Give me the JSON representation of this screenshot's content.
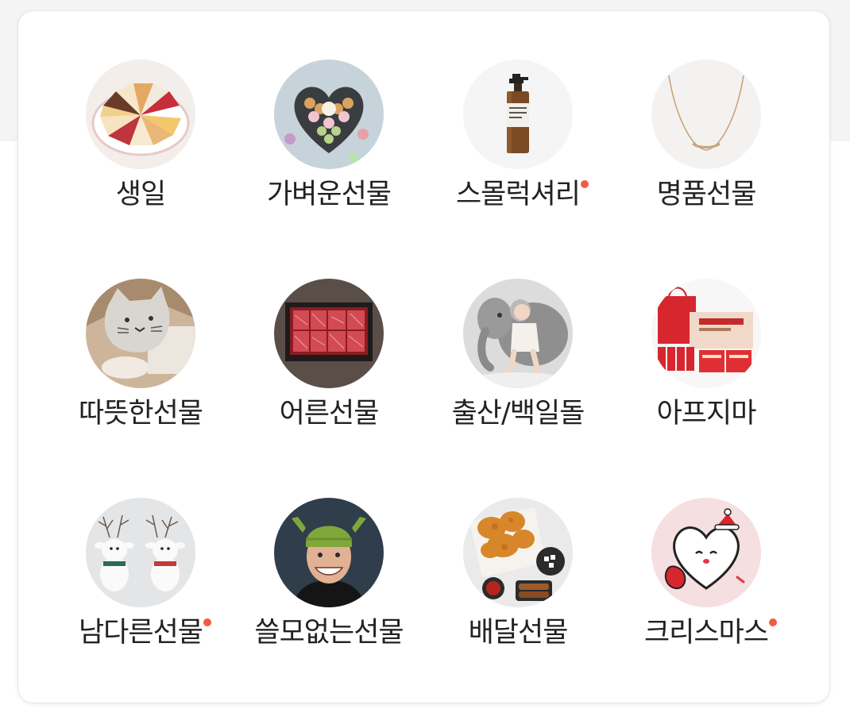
{
  "categories": [
    {
      "label": "생일",
      "icon": "birthday-cake-icon",
      "new": false
    },
    {
      "label": "가벼운선물",
      "icon": "macaron-box-icon",
      "new": false
    },
    {
      "label": "스몰럭셔리",
      "icon": "perfume-bottle-icon",
      "new": true
    },
    {
      "label": "명품선물",
      "icon": "necklace-icon",
      "new": false
    },
    {
      "label": "따뜻한선물",
      "icon": "cat-cushion-icon",
      "new": false
    },
    {
      "label": "어른선물",
      "icon": "beef-box-icon",
      "new": false
    },
    {
      "label": "출산/백일돌",
      "icon": "baby-elephant-icon",
      "new": false
    },
    {
      "label": "아프지마",
      "icon": "red-ginseng-gift-icon",
      "new": false
    },
    {
      "label": "남다른선물",
      "icon": "reindeer-figures-icon",
      "new": true
    },
    {
      "label": "쓸모없는선물",
      "icon": "shrek-hat-man-icon",
      "new": false
    },
    {
      "label": "배달선물",
      "icon": "fried-chicken-icon",
      "new": false
    },
    {
      "label": "크리스마스",
      "icon": "christmas-heart-icon",
      "new": true
    }
  ],
  "colors": {
    "new_dot": "#f15b45",
    "label": "#222222",
    "card_border": "#e6e6e6"
  }
}
